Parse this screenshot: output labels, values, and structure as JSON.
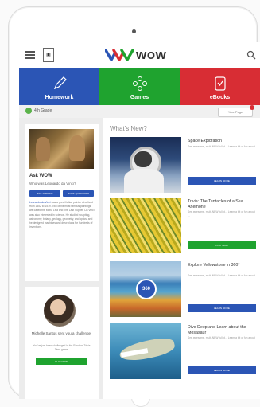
{
  "header": {
    "brand_name": "wow",
    "icons": [
      "menu-icon",
      "school-logo-icon",
      "wow-logo-icon",
      "search-icon"
    ]
  },
  "nav": {
    "tiles": [
      {
        "label": "Homework",
        "icon": "pencil-icon",
        "color": "#2b55b5"
      },
      {
        "label": "Games",
        "icon": "games-icon",
        "color": "#1fa32f"
      },
      {
        "label": "eBooks",
        "icon": "ebook-icon",
        "color": "#d82d34"
      }
    ]
  },
  "subbar": {
    "grade_label": "4th Grade",
    "your_page": "Your Page"
  },
  "ask_card": {
    "title": "Ask WOW",
    "question": "Who was Leonardo da Vinci?",
    "btn_see_answer": "SEE ANSWER",
    "btn_more_questions": "MORE QUESTIONS",
    "body_link": "Leonardo da Vinci",
    "body_text": "was a great Italian painter who lived from 1452 to 1519. Two of his most famous paintings are called the Mona Lisa and The Last Supper. Da Vinci was also interested in science. He studied sculpting, astronomy, botany, geology, geometry, and optics, and he designed machines and drew plans for hundreds of inventions."
  },
  "challenge_card": {
    "name_line": "Michelle Santos sent you a challenge.",
    "sub_line": "You've just been challenged in the Random Trivia Time game.",
    "button": "PLAY NOW"
  },
  "whats_new": {
    "title": "What's New?",
    "items": [
      {
        "title": "Space Exploration",
        "sub": "See awesome, multi-NEW full pl... Learn a bit of fun about ...",
        "button": "LEARN MORE",
        "button_color": "#2b55b5"
      },
      {
        "title": "Trivia: The Tentacles of a Sea Anemone",
        "sub": "See awesome, multi-NEW full pl... Learn a bit of fun about ...",
        "button": "PLAY NOW",
        "button_color": "#1fa32f"
      },
      {
        "title": "Explore Yellowstone in 360°",
        "sub": "See awesome, multi-NEW full pl... Learn a bit of fun about ...",
        "button": "LEARN MORE",
        "button_color": "#2b55b5"
      },
      {
        "title": "Dive Deep and Learn about the Mosasaur",
        "sub": "See awesome, multi-NEW full pl... Learn a bit of fun about ...",
        "button": "LEARN MORE",
        "button_color": "#2b55b5"
      }
    ]
  }
}
